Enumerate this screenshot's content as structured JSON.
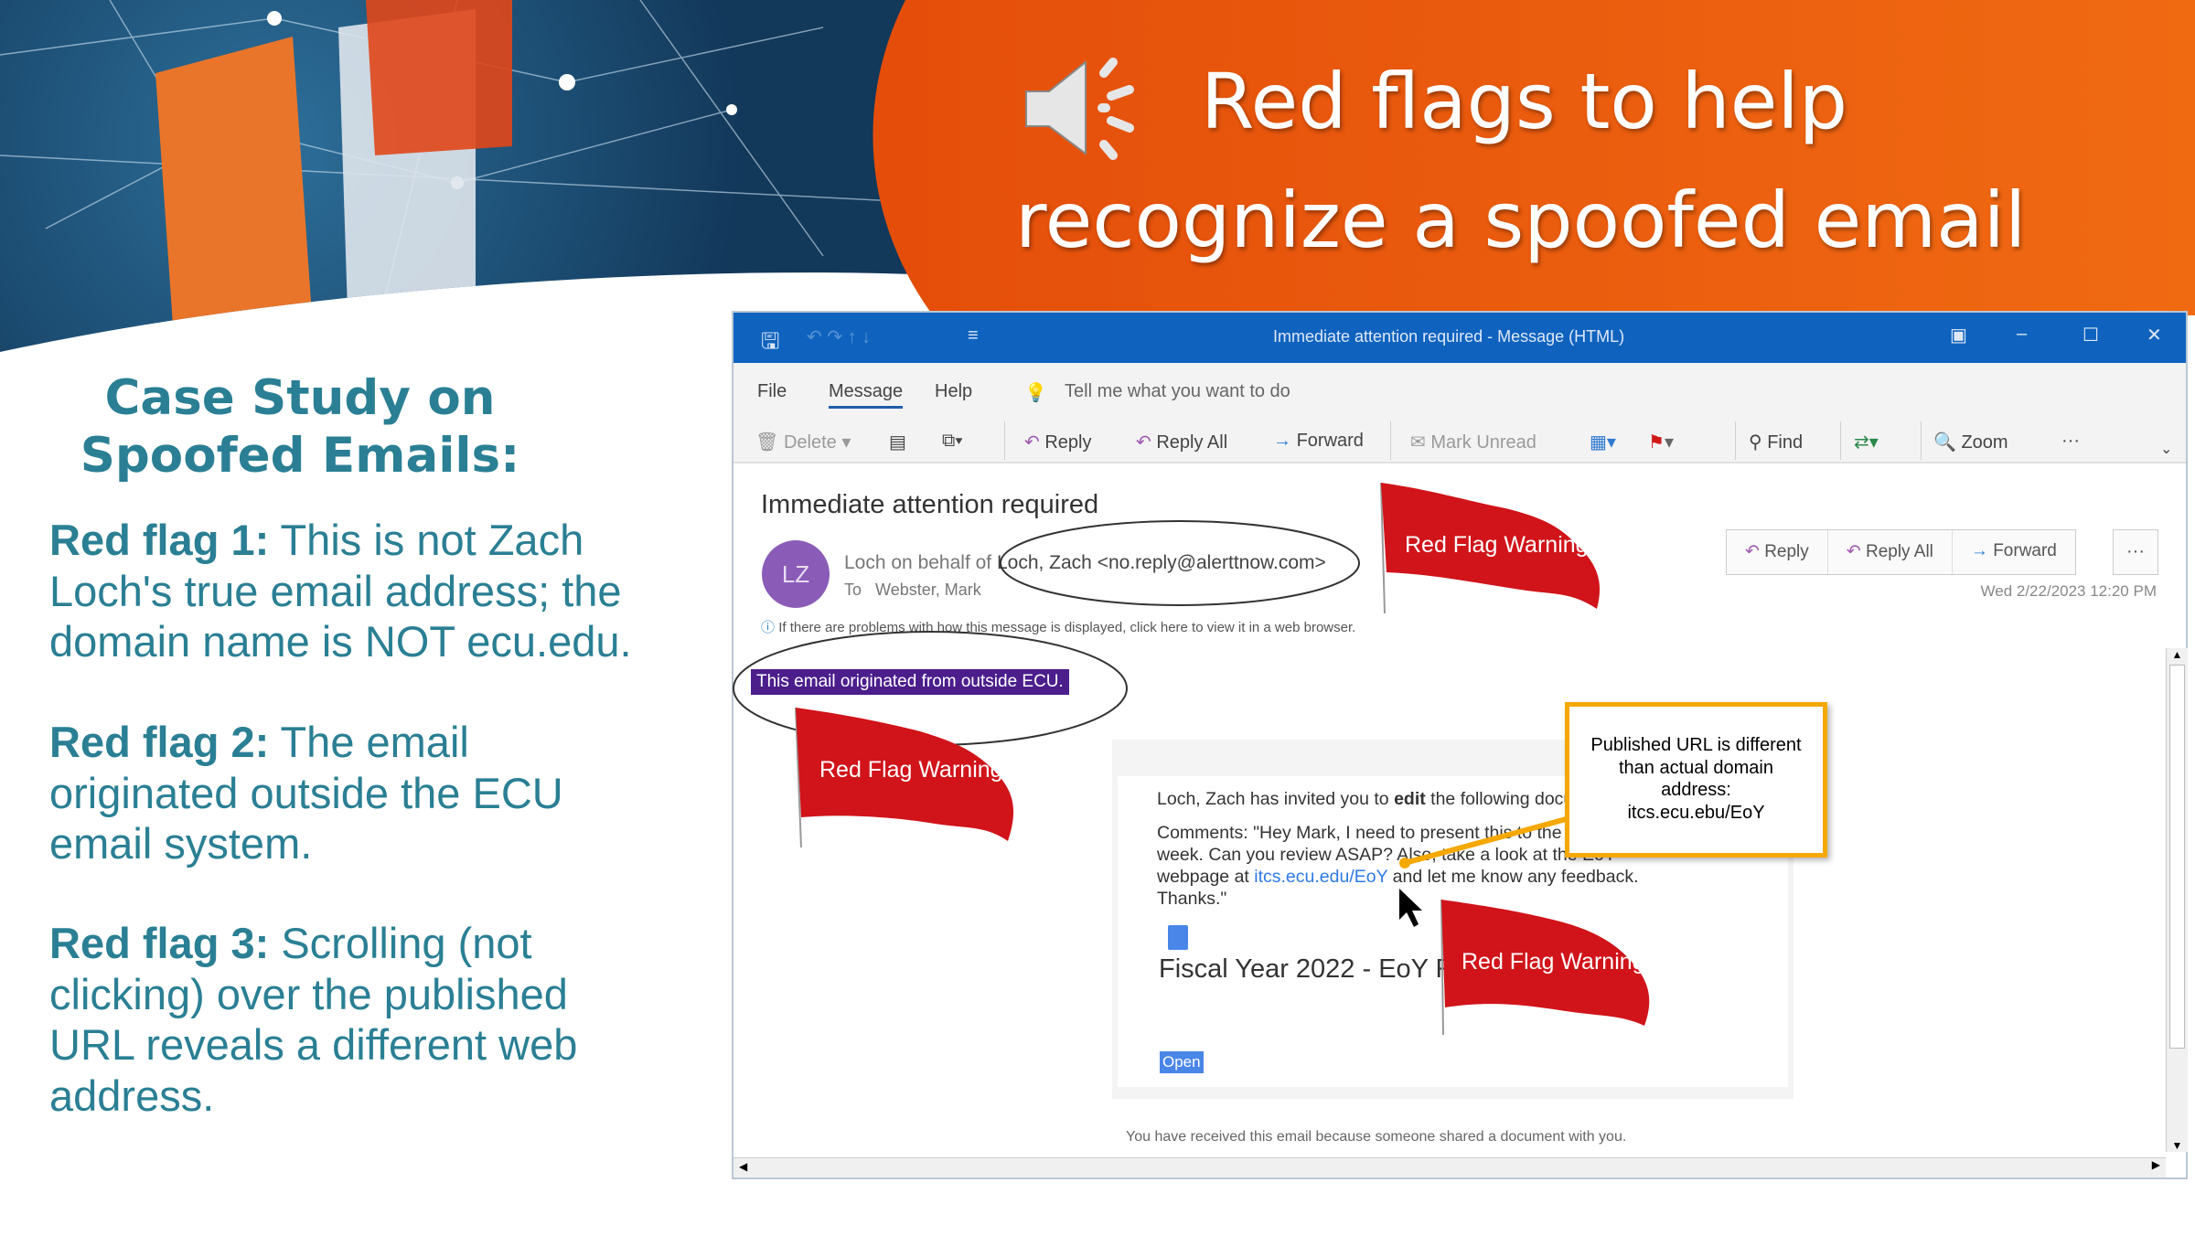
{
  "slide": {
    "title_line1": "Red flags to help",
    "title_line2": "recognize a spoofed email",
    "case_heading_1": "Case Study on",
    "case_heading_2": "Spoofed Emails:",
    "flags": [
      {
        "label": "Red flag 1:",
        "text": " This is not Zach Loch's true email address; the domain name is NOT ecu.edu."
      },
      {
        "label": "Red flag 2:",
        "text": " The email originated outside the ECU email system."
      },
      {
        "label": "Red flag 3:",
        "text": " Scrolling (not clicking) over the published URL reveals a different web address."
      }
    ],
    "flag_label": "Red Flag Warning",
    "callout": {
      "line1": "Published URL is different",
      "line2": "than actual domain",
      "line3": "address:",
      "line4": "itcs.ecu.ebu/EoY"
    },
    "colors": {
      "accent": "#2a7f94",
      "orange": "#e8560c",
      "titlebar": "#0f63bf",
      "flag": "#d0141a",
      "callout_border": "#f5a800",
      "banner": "#4b1e8c"
    }
  },
  "window": {
    "title": "Immediate attention required  -  Message (HTML)",
    "tabs": [
      "File",
      "Message",
      "Help"
    ],
    "tell_me": "Tell me what you want to do",
    "toolbar": {
      "delete": "Delete",
      "reply": "Reply",
      "reply_all": "Reply All",
      "forward": "Forward",
      "mark_unread": "Mark Unread",
      "find": "Find",
      "zoom": "Zoom",
      "more": "···"
    }
  },
  "email": {
    "subject": "Immediate attention required",
    "avatar": "LZ",
    "sender_prefix": "Loch on behalf of ",
    "sender": "Loch, Zach <no.reply@alerttnow.com>",
    "to_label": "To",
    "to": "Webster, Mark",
    "date": "Wed 2/22/2023 12:20 PM",
    "info": "If there are problems with how this message is displayed, click here to view it in a web browser.",
    "banner": "This email originated from outside ECU.",
    "actions": {
      "reply": "Reply",
      "reply_all": "Reply All",
      "forward": "Forward",
      "more": "···"
    },
    "body": {
      "invite_pre": "Loch, Zach has invited you to ",
      "invite_bold": "edit",
      "invite_post": " the following document:",
      "comment1": "Comments: \"Hey Mark, I need to present this to the",
      "comment2": "week. Can you review ASAP? Also, take a look at the EoY",
      "comment3_pre": "webpage at ",
      "link": "itcs.ecu.edu/EoY",
      "comment3_post": " and let me know any feedback.",
      "comment4": "Thanks.\"",
      "doc_title": "Fiscal Year 2022 - EoY R",
      "open": "Open",
      "footer": "You have received this email because someone shared a document with you."
    }
  }
}
